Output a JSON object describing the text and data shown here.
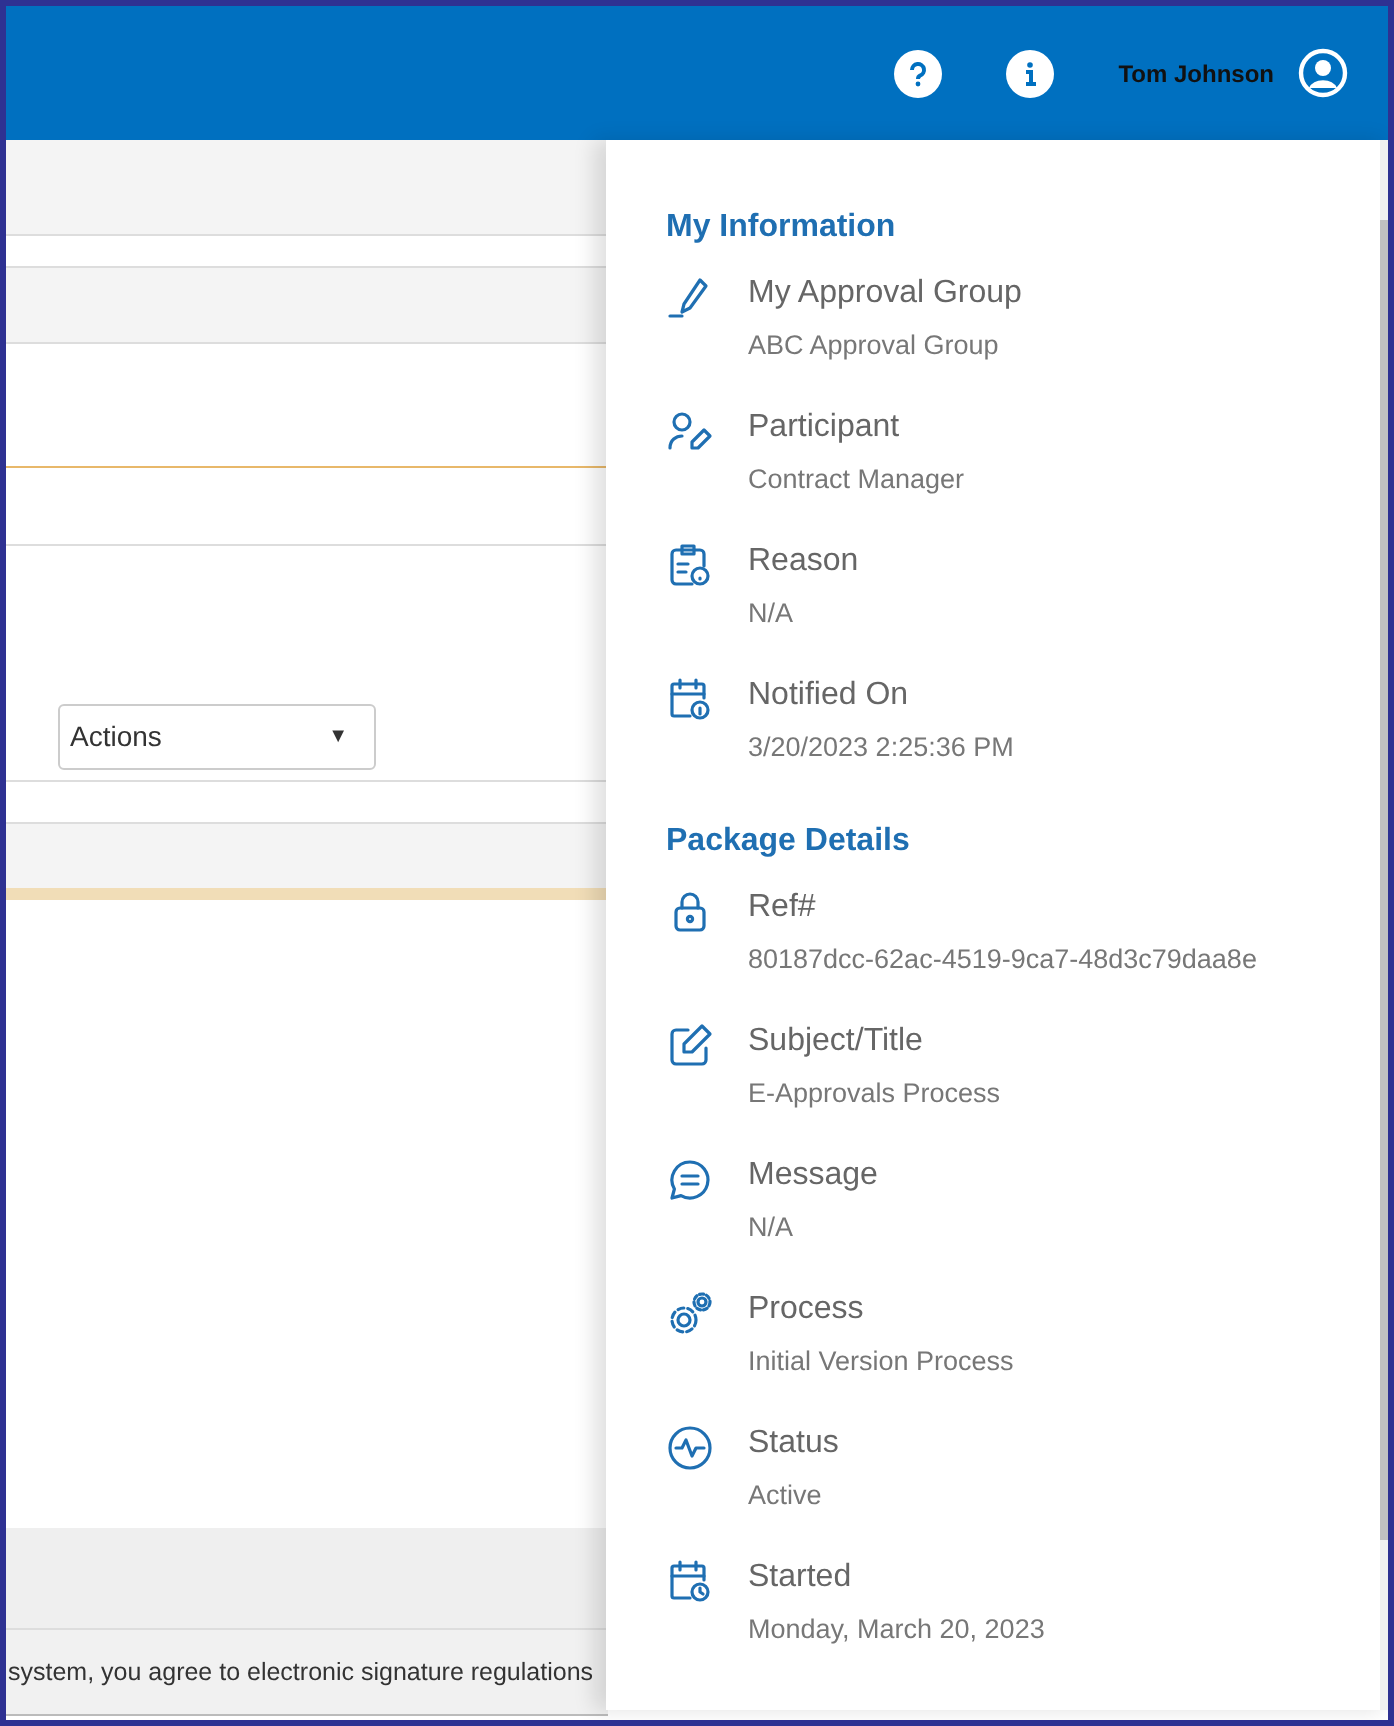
{
  "header": {
    "user_name": "Tom Johnson"
  },
  "actions_select": {
    "value": "Actions",
    "caret": "▼"
  },
  "footer": {
    "text": "system, you agree to electronic signature regulations"
  },
  "info_panel": {
    "sections": [
      {
        "title": "My Information",
        "items": [
          {
            "label": "My Approval Group",
            "value": "ABC Approval Group"
          },
          {
            "label": "Participant",
            "value": "Contract Manager"
          },
          {
            "label": "Reason",
            "value": "N/A"
          },
          {
            "label": "Notified On",
            "value": "3/20/2023 2:25:36 PM"
          }
        ]
      },
      {
        "title": "Package Details",
        "items": [
          {
            "label": "Ref#",
            "value": "80187dcc-62ac-4519-9ca7-48d3c79daa8e"
          },
          {
            "label": "Subject/Title",
            "value": "E-Approvals Process"
          },
          {
            "label": "Message",
            "value": "N/A"
          },
          {
            "label": "Process",
            "value": "Initial Version Process"
          },
          {
            "label": "Status",
            "value": "Active"
          },
          {
            "label": "Started",
            "value": "Monday, March 20, 2023"
          }
        ]
      }
    ]
  }
}
